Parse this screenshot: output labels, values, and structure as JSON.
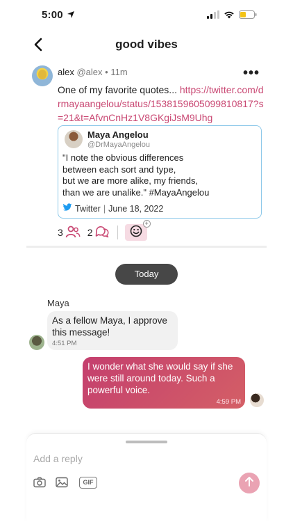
{
  "status_bar": {
    "time": "5:00"
  },
  "nav": {
    "title": "good vibes"
  },
  "post": {
    "author": "alex",
    "handle": "@alex",
    "dot": "•",
    "age": "11m",
    "text": "One of my favorite quotes...",
    "link": "https://twitter.com/drmayaangelou/status/1538159605099810817?s=21&t=AfvnCnHz1V8GKgiJsM9Uhg",
    "tweet": {
      "name": "Maya Angelou",
      "handle": "@DrMayaAngelou",
      "lines": [
        "\"I note the obvious differences",
        "between each sort and type,",
        "but we are more alike, my friends,",
        "than we are unalike.\" #MayaAngelou"
      ],
      "source": "Twitter",
      "sep": "|",
      "date": "June 18, 2022"
    },
    "participants_count": "3",
    "comments_count": "2",
    "react_plus": "+"
  },
  "chat": {
    "day_label": "Today",
    "incoming": {
      "sender": "Maya",
      "text": "As a fellow Maya, I approve this message!",
      "time": "4:51 PM"
    },
    "outgoing": {
      "text": "I wonder what she would say if she were still around today. Such a powerful voice.",
      "time": "4:59 PM"
    }
  },
  "composer": {
    "placeholder": "Add a reply",
    "gif_label": "GIF"
  },
  "colors": {
    "accent": "#c94873",
    "tweet_border": "#8cc8e9",
    "day_pill": "#474747",
    "send_button": "#eaa3b3"
  }
}
